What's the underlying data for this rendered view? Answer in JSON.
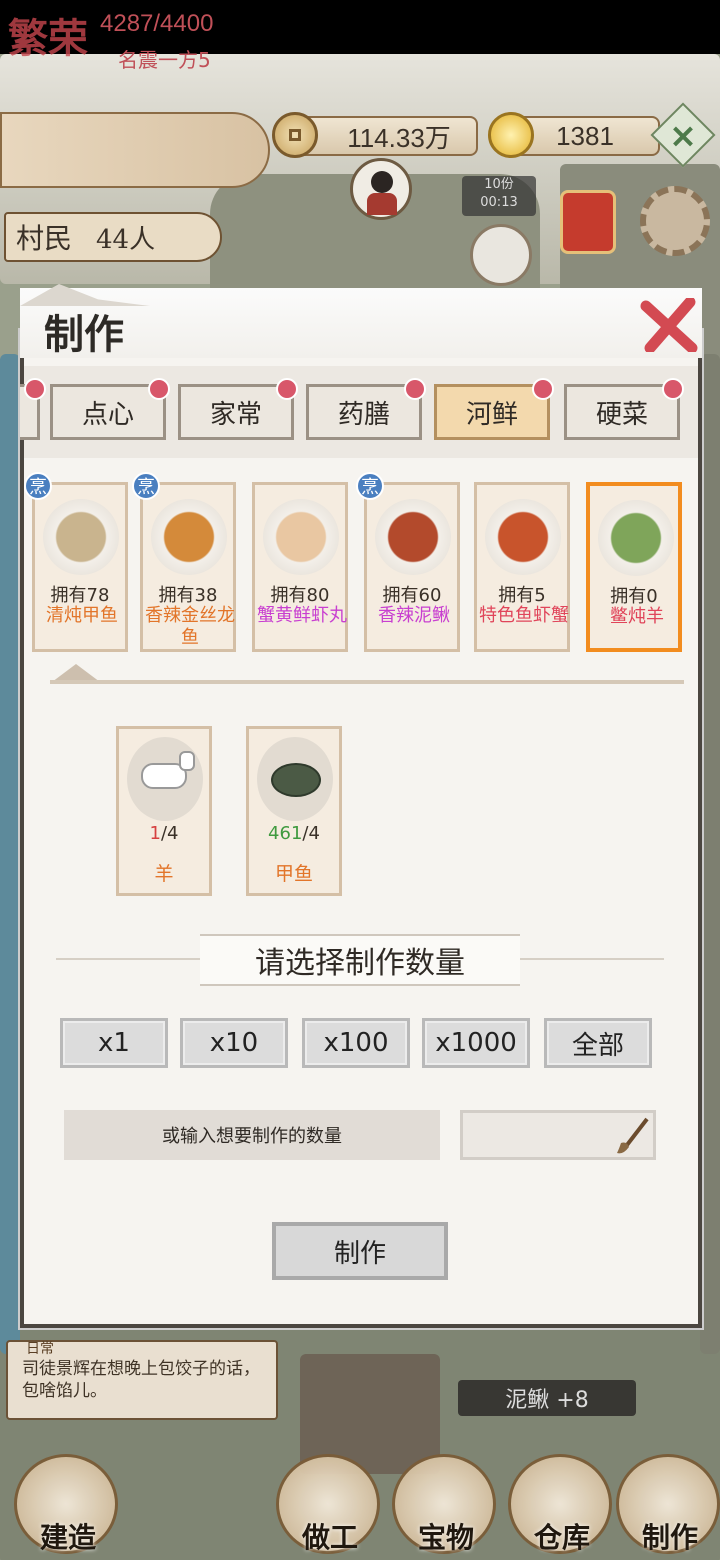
{
  "hud": {
    "fame_logo": "繁荣",
    "fame_value": "4287/4400",
    "fame_title": "名震一方5",
    "coins": "114.33万",
    "ingots": "1381",
    "add_icon": "plus-icon",
    "villager_label": "村民",
    "villager_count": "44人",
    "timer_top": "10份",
    "timer_bottom": "00:13"
  },
  "panel": {
    "title": "制作",
    "tabs": [
      {
        "label": "点心",
        "active": false
      },
      {
        "label": "家常",
        "active": false
      },
      {
        "label": "药膳",
        "active": false
      },
      {
        "label": "河鲜",
        "active": true
      },
      {
        "label": "硬菜",
        "active": false
      }
    ],
    "dishes": [
      {
        "owned": "拥有78",
        "name": "清炖甲鱼",
        "color": "#e2752a",
        "cook": true
      },
      {
        "owned": "拥有38",
        "name": "香辣金丝龙鱼",
        "color": "#e2752a",
        "cook": true
      },
      {
        "owned": "拥有80",
        "name": "蟹黄鲜虾丸",
        "color": "#c83fd0",
        "cook": false
      },
      {
        "owned": "拥有60",
        "name": "香辣泥鳅",
        "color": "#c83fd0",
        "cook": true
      },
      {
        "owned": "拥有5",
        "name": "特色鱼虾蟹",
        "color": "#e0455a",
        "cook": false
      },
      {
        "owned": "拥有0",
        "name": "鳖炖羊",
        "color": "#e0455a",
        "cook": false,
        "selected": true
      }
    ],
    "cook_tag": "烹",
    "ingredients": [
      {
        "have": "1",
        "need": "/4",
        "have_color": "#d64040",
        "name": "羊"
      },
      {
        "have": "461",
        "need": "/4",
        "have_color": "#3f9a3f",
        "name": "甲鱼"
      }
    ],
    "qty_title": "请选择制作数量",
    "qty_buttons": [
      "x1",
      "x10",
      "x100",
      "x1000",
      "全部"
    ],
    "input_label": "或输入想要制作的数量",
    "input_value": "",
    "make_button": "制作"
  },
  "daily": {
    "tag": "日常",
    "text": "司徒景辉在想晚上包饺子的话，包啥馅儿。"
  },
  "toast": "泥鳅 +8",
  "nav": [
    "建造",
    "做工",
    "宝物",
    "仓库",
    "制作"
  ]
}
